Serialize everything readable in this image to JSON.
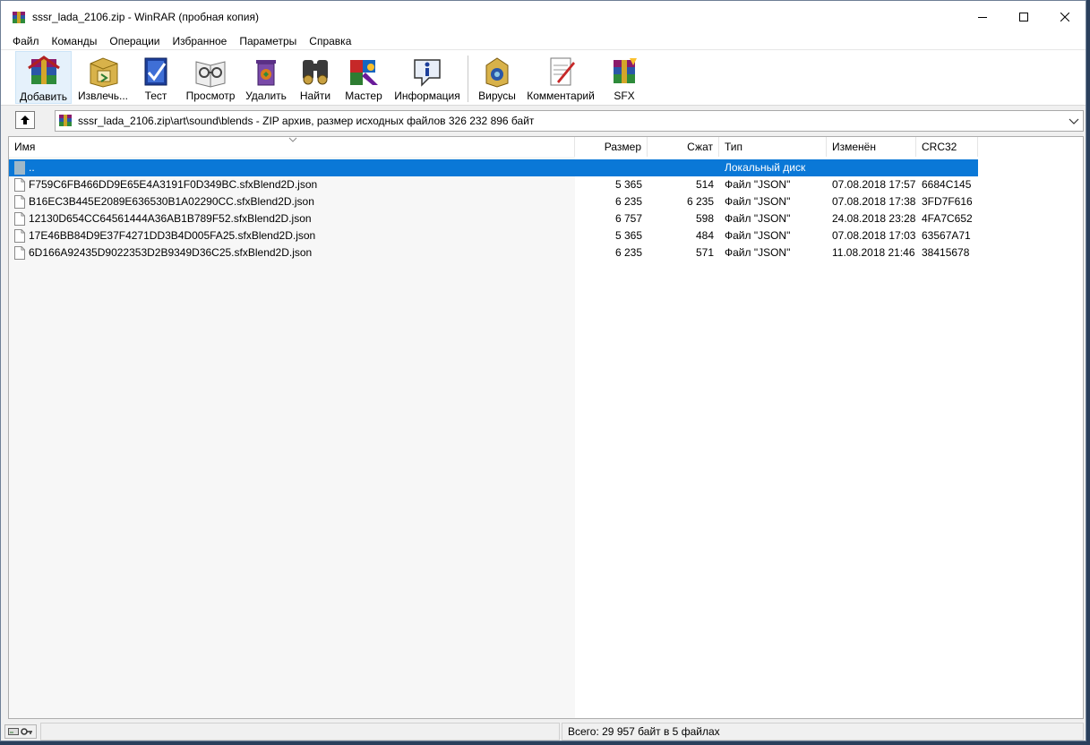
{
  "window": {
    "title": "sssr_lada_2106.zip - WinRAR (пробная копия)",
    "icon": "winrar-archive-icon"
  },
  "menu": [
    "Файл",
    "Команды",
    "Операции",
    "Избранное",
    "Параметры",
    "Справка"
  ],
  "toolbar": [
    {
      "label": "Добавить",
      "icon": "add-archive-icon"
    },
    {
      "label": "Извлечь...",
      "icon": "extract-icon"
    },
    {
      "label": "Тест",
      "icon": "test-icon"
    },
    {
      "label": "Просмотр",
      "icon": "view-icon"
    },
    {
      "label": "Удалить",
      "icon": "delete-icon"
    },
    {
      "label": "Найти",
      "icon": "find-icon"
    },
    {
      "label": "Мастер",
      "icon": "wizard-icon"
    },
    {
      "label": "Информация",
      "icon": "info-icon"
    },
    {
      "label": "Вирусы",
      "icon": "virus-scan-icon"
    },
    {
      "label": "Комментарий",
      "icon": "comment-icon"
    },
    {
      "label": "SFX",
      "icon": "sfx-icon"
    }
  ],
  "address": {
    "path": "sssr_lada_2106.zip\\art\\sound\\blends - ZIP архив, размер исходных файлов 326 232 896 байт"
  },
  "columns": [
    "Имя",
    "Размер",
    "Сжат",
    "Тип",
    "Изменён",
    "CRC32"
  ],
  "parent_row": {
    "name": "..",
    "type": "Локальный диск"
  },
  "files": [
    {
      "name": "F759C6FB466DD9E65E4A3191F0D349BC.sfxBlend2D.json",
      "size": "5 365",
      "packed": "514",
      "type": "Файл \"JSON\"",
      "modified": "07.08.2018 17:57",
      "crc": "6684C145"
    },
    {
      "name": "B16EC3B445E2089E636530B1A02290CC.sfxBlend2D.json",
      "size": "6 235",
      "packed": "6 235",
      "type": "Файл \"JSON\"",
      "modified": "07.08.2018 17:38",
      "crc": "3FD7F616"
    },
    {
      "name": "12130D654CC64561444A36AB1B789F52.sfxBlend2D.json",
      "size": "6 757",
      "packed": "598",
      "type": "Файл \"JSON\"",
      "modified": "24.08.2018 23:28",
      "crc": "4FA7C652"
    },
    {
      "name": "17E46BB84D9E37F4271DD3B4D005FA25.sfxBlend2D.json",
      "size": "5 365",
      "packed": "484",
      "type": "Файл \"JSON\"",
      "modified": "07.08.2018 17:03",
      "crc": "63567A71"
    },
    {
      "name": "6D166A92435D9022353D2B9349D36C25.sfxBlend2D.json",
      "size": "6 235",
      "packed": "571",
      "type": "Файл \"JSON\"",
      "modified": "11.08.2018 21:46",
      "crc": "38415678"
    }
  ],
  "status": {
    "total": "Всего: 29 957 байт в 5 файлах",
    "icons": [
      "drive-icon",
      "key-icon"
    ]
  },
  "colors": {
    "selection": "#0a78d7",
    "name_column_bg": "#f7f7f7"
  }
}
